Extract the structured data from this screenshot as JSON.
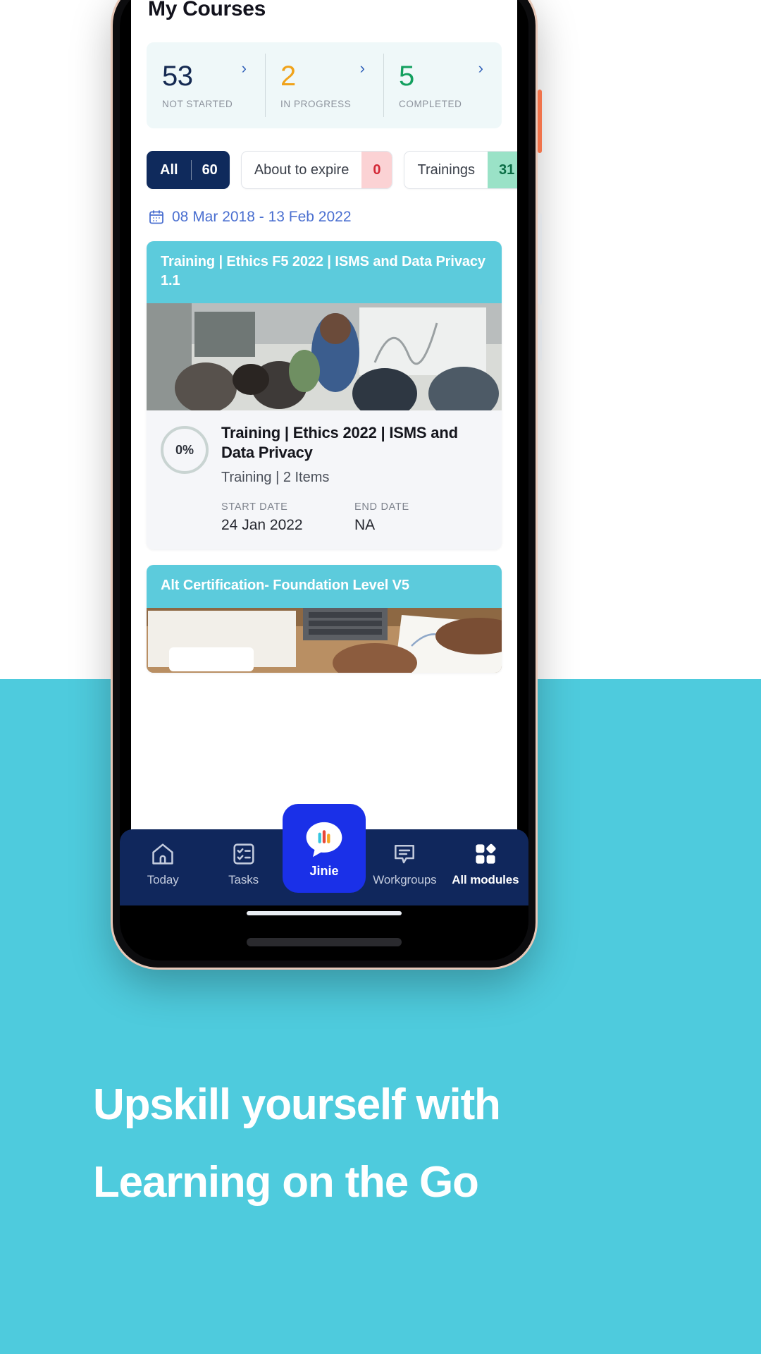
{
  "screen": {
    "page_title": "My Courses",
    "stats": [
      {
        "value": "53",
        "label": "NOT STARTED",
        "color": "#152a52",
        "arrow": "›"
      },
      {
        "value": "2",
        "label": "IN PROGRESS",
        "color": "#f0a31b",
        "arrow": "›"
      },
      {
        "value": "5",
        "label": "COMPLETED",
        "color": "#13a05f",
        "arrow": "›"
      }
    ],
    "filters": [
      {
        "label": "All",
        "count": "60",
        "state": "active"
      },
      {
        "label": "About to expire",
        "count": "0",
        "state": "danger"
      },
      {
        "label": "Trainings",
        "count": "31",
        "state": "success"
      }
    ],
    "date_filter": {
      "icon": "calendar-icon",
      "range": "08 Mar 2018 - 13 Feb 2022"
    },
    "cards": [
      {
        "banner": "Training | Ethics  F5  2022 | ISMS and Data Privacy 1.1",
        "progress": "0%",
        "title": "Training | Ethics 2022 | ISMS and Data Privacy",
        "subtitle": "Training | 2 Items",
        "start_label": "START DATE",
        "start_value": "24 Jan 2022",
        "end_label": "END DATE",
        "end_value": "NA"
      },
      {
        "banner": "Alt Certification- Foundation Level V5"
      }
    ],
    "bottom_nav": [
      {
        "label": "Today",
        "icon": "home-icon"
      },
      {
        "label": "Tasks",
        "icon": "checklist-icon"
      },
      {
        "label": "Jinie",
        "icon": "jinie-chat-icon"
      },
      {
        "label": "Workgroups",
        "icon": "message-icon"
      },
      {
        "label": "All modules",
        "icon": "grid-modules-icon"
      }
    ]
  },
  "marketing": {
    "headline_line1": "Upskill yourself with",
    "headline_line2": "Learning on the Go"
  },
  "colors": {
    "accent_cyan": "#4ecbdd",
    "navy": "#10275c",
    "jinie_blue": "#1a30e8",
    "amber": "#f0a31b",
    "green": "#13a05f",
    "danger": "#d32836"
  }
}
